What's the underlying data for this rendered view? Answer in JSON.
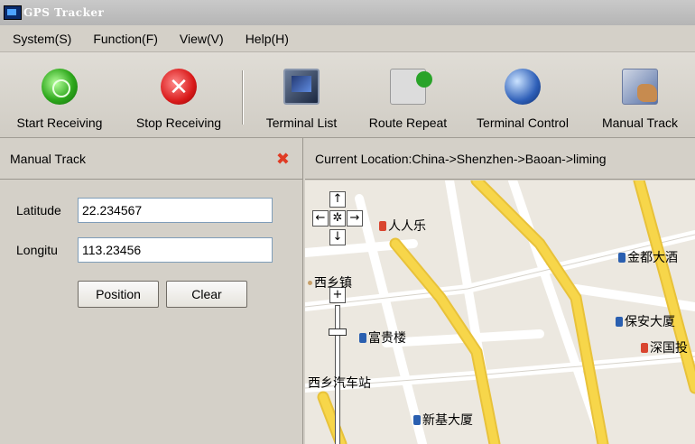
{
  "window": {
    "title": "GPS Tracker"
  },
  "menu": {
    "items": [
      {
        "label": "System(S)"
      },
      {
        "label": "Function(F)"
      },
      {
        "label": "View(V)"
      },
      {
        "label": "Help(H)"
      }
    ]
  },
  "toolbar": {
    "buttons": [
      {
        "label": "Start Receiving",
        "icon": "start-receiving-icon"
      },
      {
        "label": "Stop Receiving",
        "icon": "stop-receiving-icon"
      },
      {
        "label": "Terminal List",
        "icon": "monitor-icon"
      },
      {
        "label": "Route Repeat",
        "icon": "play-icon"
      },
      {
        "label": "Terminal Control",
        "icon": "globe-monitor-icon"
      },
      {
        "label": "Manual Track",
        "icon": "hand-icon"
      }
    ]
  },
  "panel": {
    "title": "Manual Track",
    "latitude": {
      "label": "Latitude",
      "value": "22.234567"
    },
    "longitude": {
      "label": "Longitu",
      "value": "113.23456"
    },
    "position_button": "Position",
    "clear_button": "Clear"
  },
  "map": {
    "location": "Current Location:China->Shenzhen->Baoan->liming",
    "pois": [
      {
        "name": "人人乐"
      },
      {
        "name": "金都大酒"
      },
      {
        "name": "西乡镇"
      },
      {
        "name": "富贵楼"
      },
      {
        "name": "保安大厦"
      },
      {
        "name": "深国投"
      },
      {
        "name": "西乡汽车站"
      },
      {
        "name": "新基大厦"
      }
    ],
    "colors": {
      "road": "#f7d64a",
      "road_minor": "#ffffff",
      "land": "#ece8e0"
    }
  }
}
